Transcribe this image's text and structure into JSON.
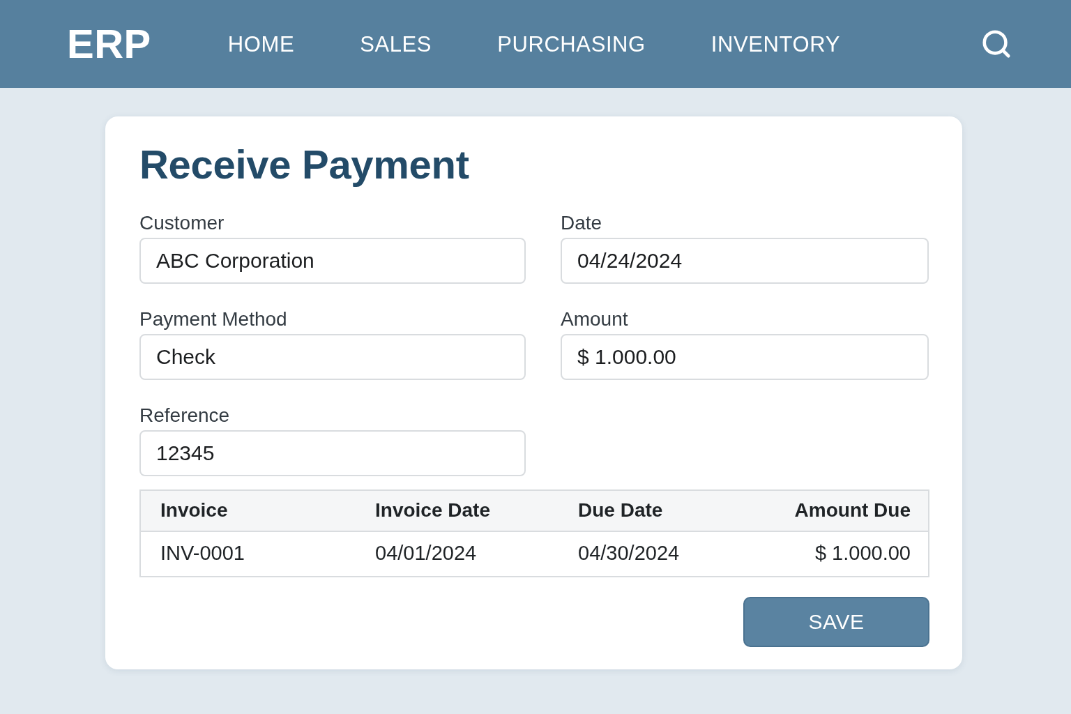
{
  "header": {
    "logo": "ERP",
    "nav": [
      {
        "label": "HOME"
      },
      {
        "label": "SALES"
      },
      {
        "label": "PURCHASING"
      },
      {
        "label": "INVENTORY"
      }
    ]
  },
  "form": {
    "title": "Receive Payment",
    "fields": [
      {
        "label": "Customer",
        "value": "ABC Corporation"
      },
      {
        "label": "Date",
        "value": "04/24/2024"
      },
      {
        "label": "Payment Method",
        "value": "Check"
      },
      {
        "label": "Amount",
        "value": "$ 1.000.00"
      },
      {
        "label": "Reference",
        "value": "12345"
      }
    ],
    "table": {
      "columns": [
        "Invoice",
        "Invoice Date",
        "Due Date",
        "Amount Due"
      ],
      "rows": [
        [
          "INV-0001",
          "04/01/2024",
          "04/30/2024",
          "$ 1.000.00"
        ]
      ]
    },
    "buttons": [
      {
        "label": "SAVE"
      }
    ]
  }
}
